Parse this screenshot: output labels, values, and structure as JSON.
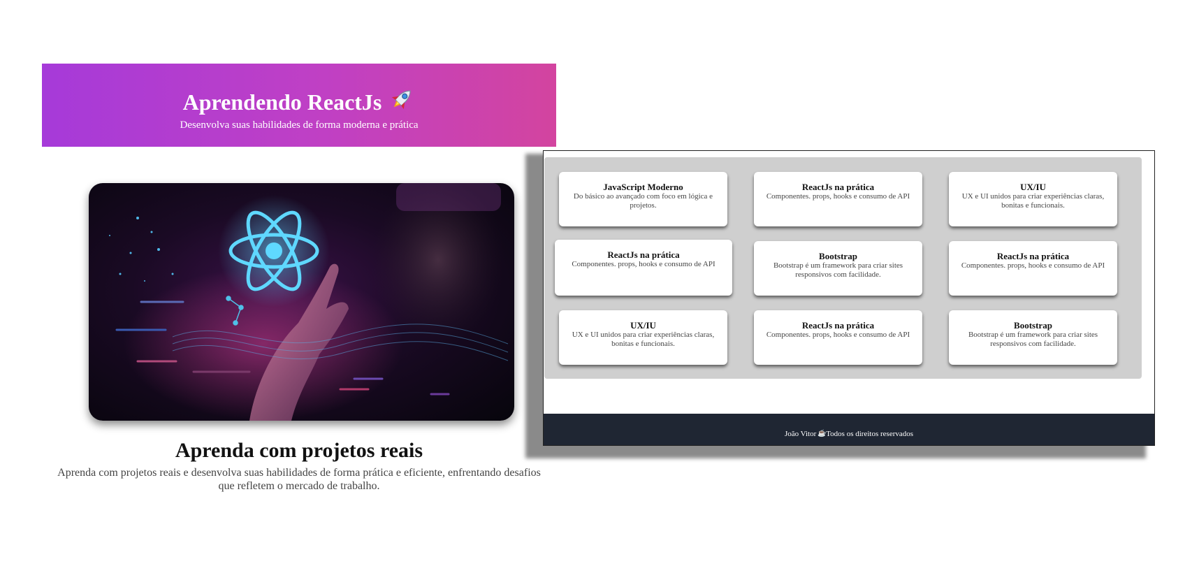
{
  "header": {
    "title": "Aprendendo ReactJs",
    "title_emoji": "🚀",
    "subtitle": "Desenvolva suas habilidades de forma moderna e prática",
    "gradient_start": "#a63ad9",
    "gradient_end": "#d3449f"
  },
  "hero": {
    "title": "Aprenda com projetos reais",
    "text": "Aprenda com projetos reais e desenvolva suas habilidades de forma prática e eficiente, enfrentando desafios que refletem o mercado de trabalho."
  },
  "cards": [
    {
      "title": "JavaScript Moderno",
      "description": "Do básico ao avançado com foco em lógica e projetos."
    },
    {
      "title": "ReactJs na prática",
      "description": "Componentes. props, hooks e consumo de API"
    },
    {
      "title": "UX/IU",
      "description": "UX e UI unidos para criar experiências claras, bonitas e funcionais."
    },
    {
      "title": "ReactJs na prática",
      "description": "Componentes. props, hooks e consumo de API"
    },
    {
      "title": "Bootstrap",
      "description": "Bootstrap é um framework para criar sites responsivos com facilidade."
    },
    {
      "title": "ReactJs na prática",
      "description": "Componentes. props, hooks e consumo de API"
    },
    {
      "title": "UX/IU",
      "description": "UX e UI unidos para criar experiências claras, bonitas e funcionais."
    },
    {
      "title": "ReactJs na prática",
      "description": "Componentes. props, hooks e consumo de API"
    },
    {
      "title": "Bootstrap",
      "description": "Bootstrap é um framework para criar sites responsivos com facilidade."
    }
  ],
  "footer": {
    "author": "João Vitor",
    "icon": "mug-icon",
    "rights": "Todos os direitos reservados",
    "background": "#1f2633"
  }
}
